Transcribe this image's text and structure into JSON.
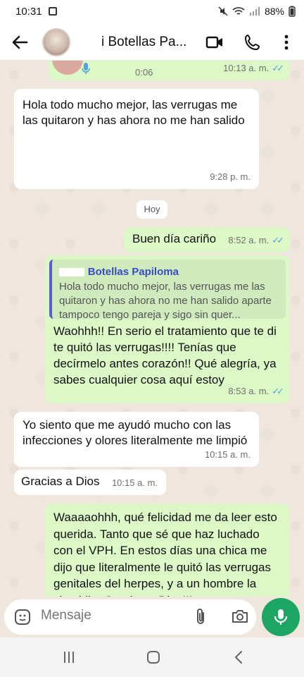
{
  "status": {
    "time": "10:31",
    "battery": "88%"
  },
  "header": {
    "contact_name": "i Botellas Pa..."
  },
  "messages": {
    "voice": {
      "duration": "0:06",
      "time": "10:13 a. m."
    },
    "m1": {
      "text": "Hola todo mucho mejor, las verrugas me las quitaron y has ahora no me han salido",
      "time": "9:28 p. m."
    },
    "day": "Hoy",
    "m2": {
      "text": "Buen día cariño",
      "time": "8:52 a. m."
    },
    "m3": {
      "quote_name": "Botellas Papiloma",
      "quote_text": "Hola todo mucho mejor, las verrugas me las quitaron y has ahora no me han salido aparte tampoco tengo pareja y sigo sin quer...",
      "text": "Waohhh!! En serio el tratamiento que te di te quitó las verrugas!!!! Tenías que decírmelo antes corazón!! Qué alegría, ya sabes cualquier cosa aquí estoy",
      "time": "8:53 a. m."
    },
    "m4": {
      "text": "Yo siento que me ayudó mucho con las infecciones y olores literalmente me limpió",
      "time": "10:15 a. m."
    },
    "m5": {
      "text": "Gracias a Dios",
      "time": "10:15 a. m."
    },
    "m6": {
      "text": "Waaaaohhh, qué felicidad me da leer esto querida. Tanto que sé que haz luchado con el VPH. En estos días una chica me dijo que literalmente le quitó las verrugas genitales del herpes, y a un hombre la clamidia. Gracias a Dios!!!"
    }
  },
  "input": {
    "placeholder": "Mensaje"
  },
  "colors": {
    "outgoing": "#dcf8c6",
    "incoming": "#ffffff",
    "accent": "#1da564",
    "read_ticks": "#4fa3e0"
  },
  "icons": [
    "back-arrow-icon",
    "video-call-icon",
    "phone-icon",
    "more-vert-icon",
    "emoji-icon",
    "attach-icon",
    "camera-icon",
    "mic-icon",
    "nav-recents-icon",
    "nav-home-icon",
    "nav-back-icon"
  ]
}
